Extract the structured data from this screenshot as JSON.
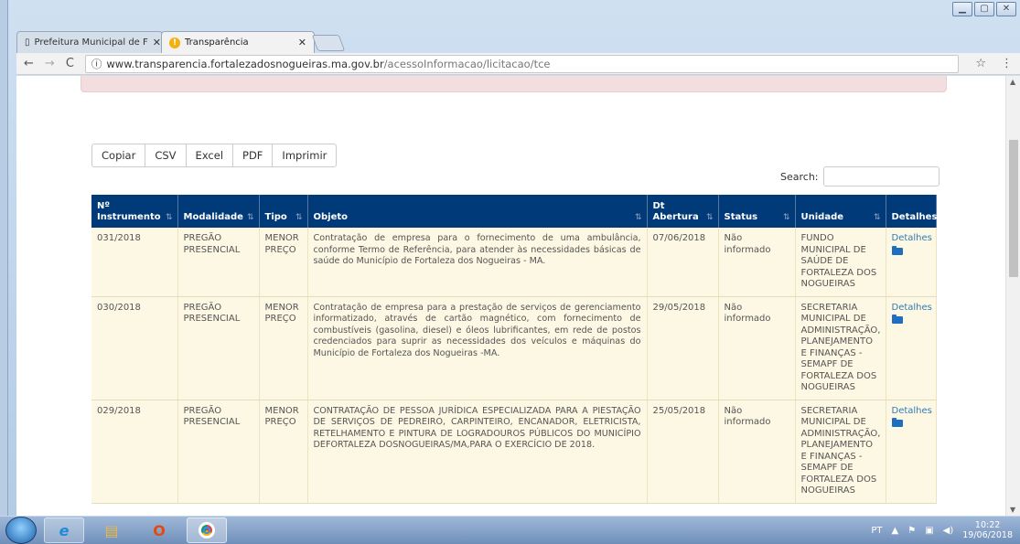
{
  "browser": {
    "tabs": [
      {
        "label": "Prefeitura Municipal de F",
        "active": false
      },
      {
        "label": "Transparência",
        "active": true
      }
    ],
    "url_host": "www.transparencia.fortalezadosnogueiras.ma.gov.br",
    "url_path": "/acessoInformacao/licitacao/tce",
    "url_info_icon": "ⓘ"
  },
  "export_buttons": [
    "Copiar",
    "CSV",
    "Excel",
    "PDF",
    "Imprimir"
  ],
  "search": {
    "label": "Search:",
    "value": ""
  },
  "table": {
    "columns": [
      "Nº Instrumento",
      "Modalidade",
      "Tipo",
      "Objeto",
      "Dt Abertura",
      "Status",
      "Unidade",
      "Detalhes"
    ],
    "rows": [
      {
        "instrumento": "031/2018",
        "modalidade": "PREGÃO PRESENCIAL",
        "tipo": "MENOR PREÇO",
        "objeto": "Contratação de empresa para o fornecimento de uma ambulância, conforme Termo de Referência, para atender às necessidades básicas de saúde do Município de Fortaleza dos Nogueiras - MA.",
        "abertura": "07/06/2018",
        "status": "Não informado",
        "unidade": "FUNDO MUNICIPAL DE SAÚDE DE FORTALEZA DOS NOGUEIRAS",
        "detalhes": "Detalhes"
      },
      {
        "instrumento": "030/2018",
        "modalidade": "PREGÃO PRESENCIAL",
        "tipo": "MENOR PREÇO",
        "objeto": "Contratação de empresa para a prestação de serviços de gerenciamento informatizado, através de cartão magnético, com fornecimento de combustíveis (gasolina, diesel) e óleos lubrificantes, em rede de postos credenciados para suprir as necessidades dos veículos e máquinas do Município de Fortaleza dos Nogueiras -MA.",
        "abertura": "29/05/2018",
        "status": "Não informado",
        "unidade": "SECRETARIA MUNICIPAL DE ADMINISTRAÇÃO, PLANEJAMENTO E FINANÇAS - SEMAPF DE FORTALEZA DOS NOGUEIRAS",
        "detalhes": "Detalhes"
      },
      {
        "instrumento": "029/2018",
        "modalidade": "PREGÃO PRESENCIAL",
        "tipo": "MENOR PREÇO",
        "objeto": "CONTRATAÇÃO DE PESSOA JURÍDICA ESPECIALIZADA PARA A PIESTAÇÃO DE SERVIÇOS DE PEDREIRO, CARPINTEIRO, ENCANADOR, ELETRICISTA, RETELHAMENTO E PINTURA DE LOGRADOUROS PÚBLICOS DO MUNICÍPIO DEFORTALEZA DOSNOGUEIRAS/MA,PARA O EXERCÍCIO DE 2018.",
        "abertura": "25/05/2018",
        "status": "Não informado",
        "unidade": "SECRETARIA MUNICIPAL DE ADMINISTRAÇÃO, PLANEJAMENTO E FINANÇAS - SEMAPF DE FORTALEZA DOS NOGUEIRAS",
        "detalhes": "Detalhes"
      }
    ]
  },
  "taskbar": {
    "lang": "PT",
    "time": "10:22",
    "date": "19/06/2018"
  }
}
